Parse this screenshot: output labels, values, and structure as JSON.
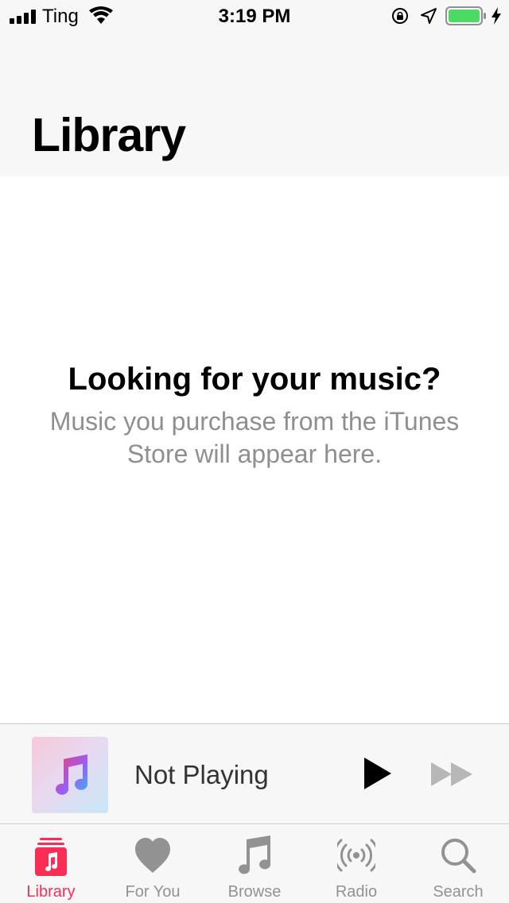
{
  "status_bar": {
    "carrier": "Ting",
    "time": "3:19 PM",
    "icons": [
      "signal-icon",
      "wifi-icon",
      "rotation-lock-icon",
      "location-icon",
      "battery-icon",
      "charging-bolt-icon"
    ]
  },
  "header": {
    "title": "Library"
  },
  "empty_state": {
    "heading": "Looking for your music?",
    "body": "Music you purchase from the iTunes Store will appear here."
  },
  "mini_player": {
    "artwork_icon": "music-note-icon",
    "status": "Not Playing",
    "controls": [
      "play-icon",
      "fast-forward-icon"
    ]
  },
  "tab_bar": {
    "active_color": "#fa2d55",
    "inactive_color": "#929292",
    "tabs": [
      {
        "label": "Library",
        "icon": "library-icon",
        "active": true
      },
      {
        "label": "For You",
        "icon": "heart-icon",
        "active": false
      },
      {
        "label": "Browse",
        "icon": "music-note-icon",
        "active": false
      },
      {
        "label": "Radio",
        "icon": "radio-icon",
        "active": false
      },
      {
        "label": "Search",
        "icon": "search-icon",
        "active": false
      }
    ]
  }
}
